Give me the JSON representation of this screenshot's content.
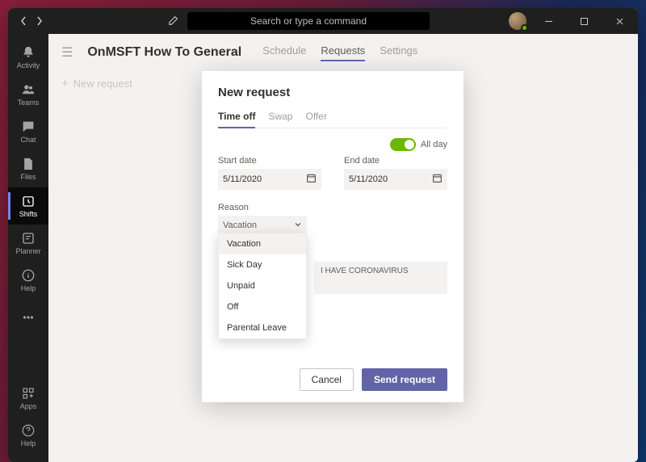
{
  "titlebar": {
    "search_placeholder": "Search or type a command"
  },
  "rail": {
    "items": [
      {
        "key": "activity",
        "label": "Activity"
      },
      {
        "key": "teams",
        "label": "Teams"
      },
      {
        "key": "chat",
        "label": "Chat"
      },
      {
        "key": "files",
        "label": "Files"
      },
      {
        "key": "shifts",
        "label": "Shifts"
      },
      {
        "key": "planner",
        "label": "Planner"
      },
      {
        "key": "help",
        "label": "Help"
      }
    ],
    "bottom": [
      {
        "key": "apps",
        "label": "Apps"
      },
      {
        "key": "help2",
        "label": "Help"
      }
    ],
    "selected": "shifts"
  },
  "header": {
    "team_title": "OnMSFT How To General",
    "tabs": [
      {
        "key": "schedule",
        "label": "Schedule"
      },
      {
        "key": "requests",
        "label": "Requests"
      },
      {
        "key": "settings",
        "label": "Settings"
      }
    ],
    "selected_tab": "requests"
  },
  "subbar": {
    "new_request": "New request"
  },
  "dialog": {
    "title": "New request",
    "tabs": [
      {
        "key": "timeoff",
        "label": "Time off"
      },
      {
        "key": "swap",
        "label": "Swap"
      },
      {
        "key": "offer",
        "label": "Offer"
      }
    ],
    "selected_tab": "timeoff",
    "all_day_label": "All day",
    "all_day_on": true,
    "start_label": "Start date",
    "start_value": "5/11/2020",
    "end_label": "End date",
    "end_value": "5/11/2020",
    "reason_label": "Reason",
    "reason_value": "Vacation",
    "reason_options": [
      "Vacation",
      "Sick Day",
      "Unpaid",
      "Off",
      "Parental Leave"
    ],
    "note_value": "I HAVE CORONAVIRUS",
    "cancel_label": "Cancel",
    "send_label": "Send request"
  }
}
